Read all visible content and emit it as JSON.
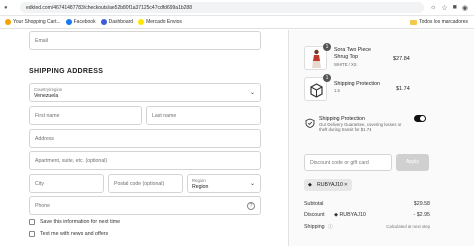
{
  "browser": {
    "url": "edkted.com/46741487783/checkouts/ae52b80f1a37125c47cdfd699a1b288",
    "bookmarks": [
      {
        "label": "Your Shopping Cart...",
        "color": "#f4a300"
      },
      {
        "label": "Facebook",
        "color": "#1877f2"
      },
      {
        "label": "Dashboard",
        "color": "#3b5bdb"
      },
      {
        "label": "Mercado Envios",
        "color": "#ffe600"
      }
    ],
    "all_bookmarks": "Todos los marcadores"
  },
  "form": {
    "email_placeholder": "Email",
    "shipping_title": "SHIPPING ADDRESS",
    "country_label": "Country/region",
    "country_value": "Venezuela",
    "first_name": "First name",
    "last_name": "Last name",
    "address": "Address",
    "apartment": "Apartment, suite, etc. (optional)",
    "city": "City",
    "postal": "Postal code (optional)",
    "region_label": "Region",
    "region_value": "Region",
    "phone": "Phone",
    "save_info": "Save this information for next time",
    "news": "Text me with news and offers"
  },
  "order": {
    "items": [
      {
        "qty": "1",
        "name": "Sora Two Piece Shrug Top",
        "variant": "WHITE / XS",
        "price": "$27.84"
      },
      {
        "qty": "1",
        "name": "Shipping Protection",
        "variant": "1.5",
        "price": "$1.74"
      }
    ],
    "protection_title": "Shipping Protection",
    "protection_desc": "Our Delivery Guarantee, covering losses or theft during transit for $1.74",
    "discount_placeholder": "Discount code or gift card",
    "apply": "Apply",
    "code": "RUBYAJ10",
    "subtotal_label": "Subtotal",
    "subtotal_value": "$29.58",
    "discount_label": "Discount",
    "discount_code": "RUBYAJ10",
    "discount_value": "- $2.95",
    "shipping_label": "Shipping",
    "shipping_value": "Calculated at next step"
  }
}
